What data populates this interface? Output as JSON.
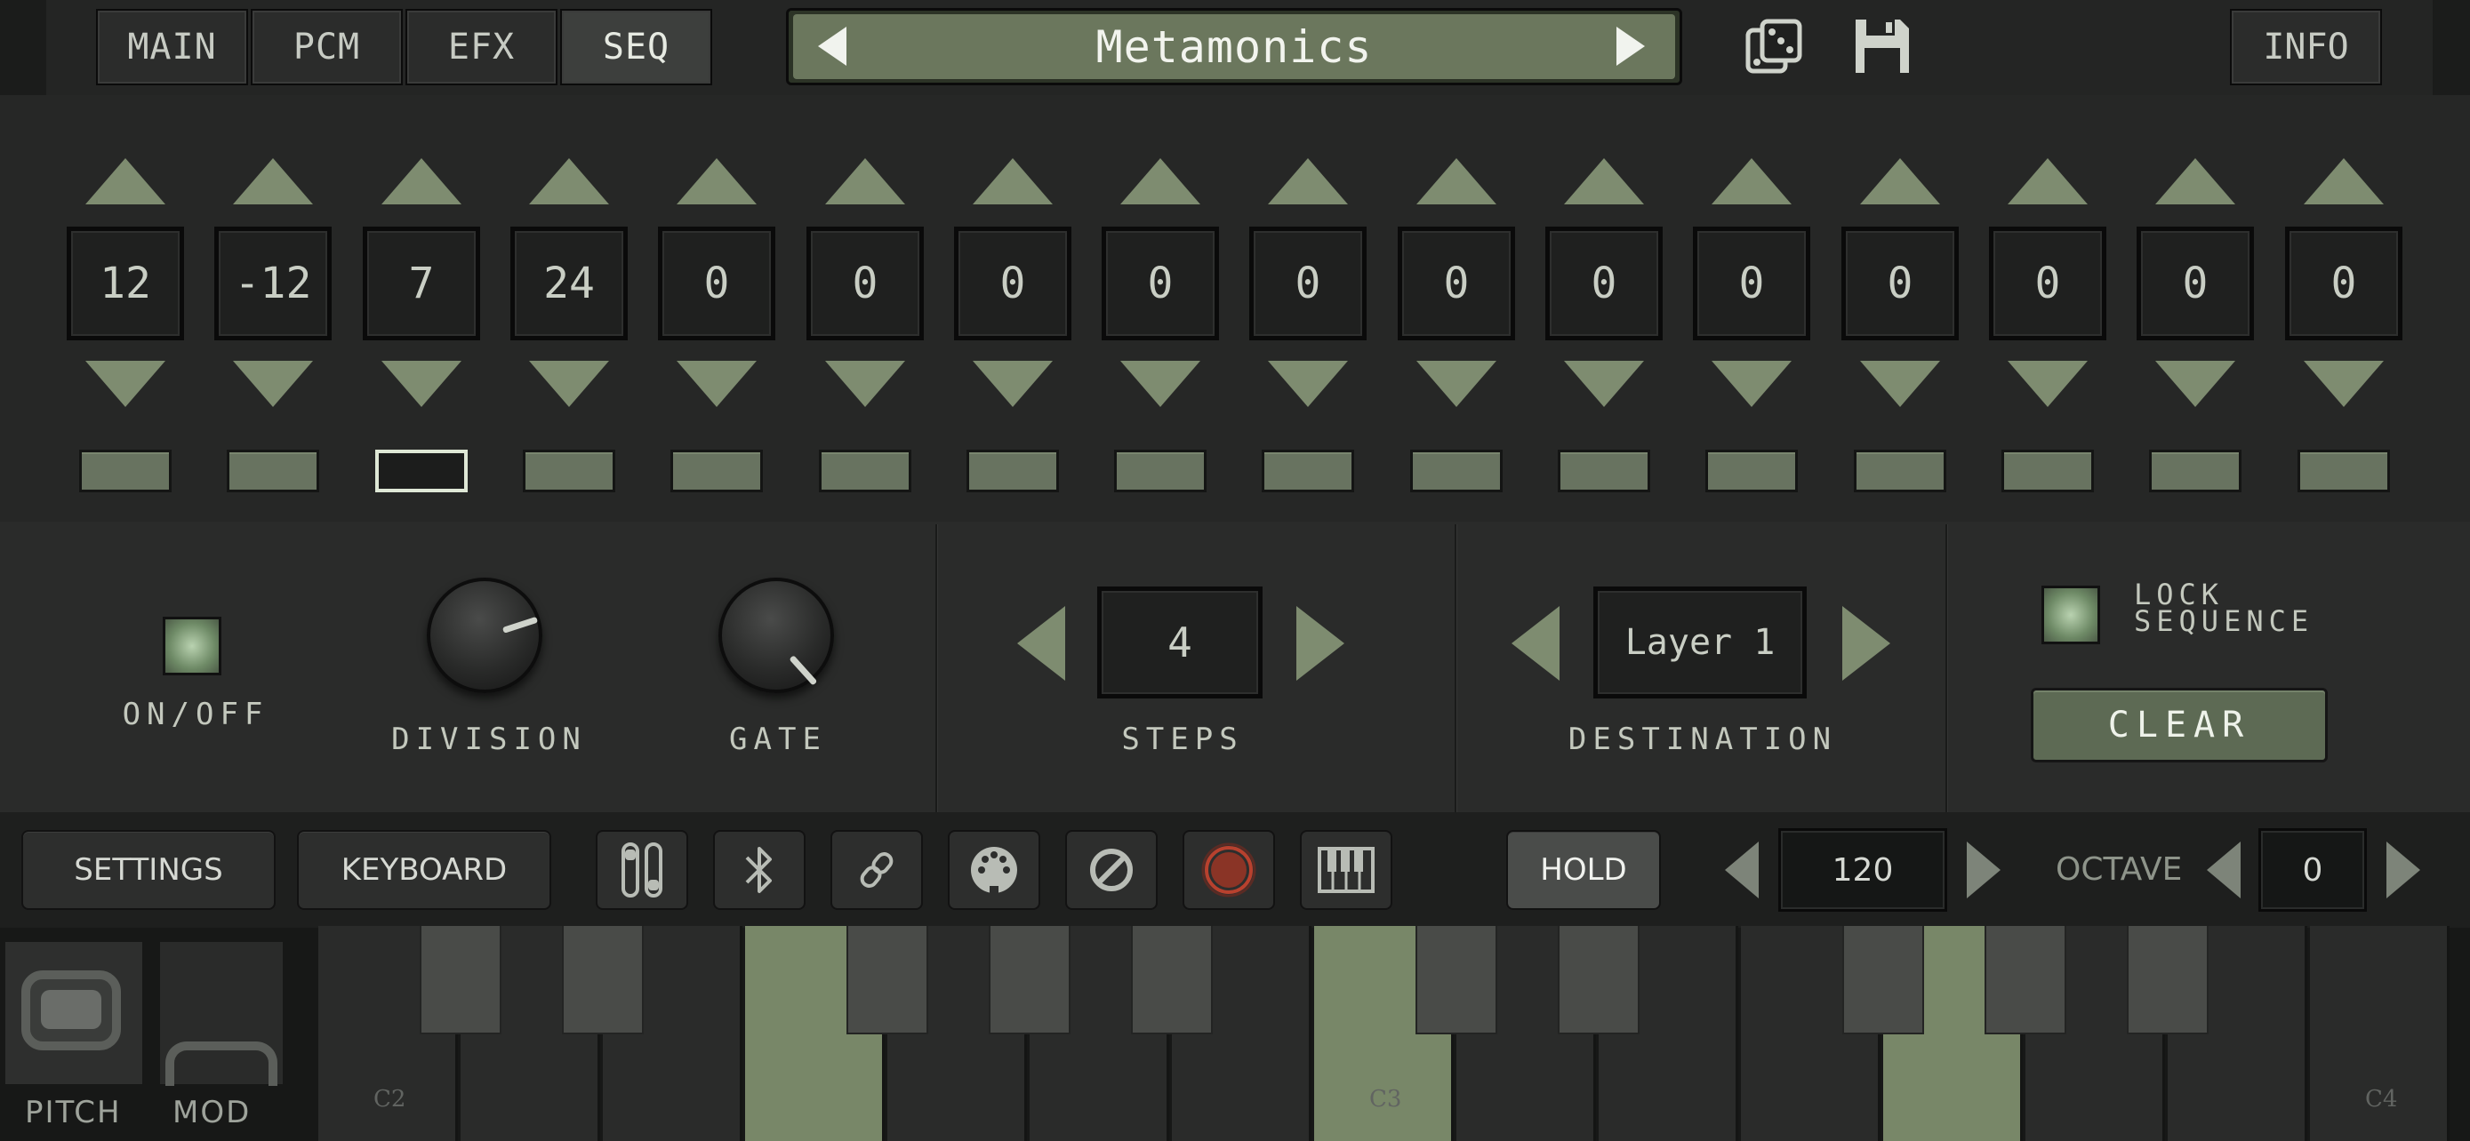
{
  "tabs": [
    {
      "label": "MAIN",
      "active": false
    },
    {
      "label": "PCM",
      "active": false
    },
    {
      "label": "EFX",
      "active": false
    },
    {
      "label": "SEQ",
      "active": true
    }
  ],
  "preset": {
    "name": "Metamonics"
  },
  "header_icons": [
    "dice-icon",
    "save-icon"
  ],
  "info_label": "INFO",
  "steps": [
    "12",
    "-12",
    "7",
    "24",
    "0",
    "0",
    "0",
    "0",
    "0",
    "0",
    "0",
    "0",
    "0",
    "0",
    "0",
    "0"
  ],
  "active_step_index": 2,
  "controls": {
    "onoff_label": "ON/OFF",
    "division_label": "DIVISION",
    "gate_label": "GATE",
    "steps_value": "4",
    "steps_label": "STEPS",
    "destination_value": "Layer 1",
    "destination_label": "DESTINATION",
    "lock_label_1": "LOCK",
    "lock_label_2": "SEQUENCE",
    "clear_label": "CLEAR"
  },
  "toolbar": {
    "settings_label": "SETTINGS",
    "keyboard_label": "KEYBOARD",
    "icons": [
      "mixer-icon",
      "bluetooth-icon",
      "link-icon",
      "midi-icon",
      "block-icon",
      "record-icon",
      "piano-icon"
    ],
    "hold_label": "HOLD",
    "tempo_value": "120",
    "octave_label": "OCTAVE",
    "octave_value": "0"
  },
  "strips": {
    "pitch_label": "PITCH",
    "mod_label": "MOD"
  },
  "keyboard": {
    "octave_labels": [
      "C2",
      "C3",
      "C4"
    ],
    "lit_white_keys": [
      3,
      7,
      11
    ]
  },
  "colors": {
    "accent": "#7e8c70",
    "lit_key": "#788768",
    "record": "#b8412e"
  }
}
